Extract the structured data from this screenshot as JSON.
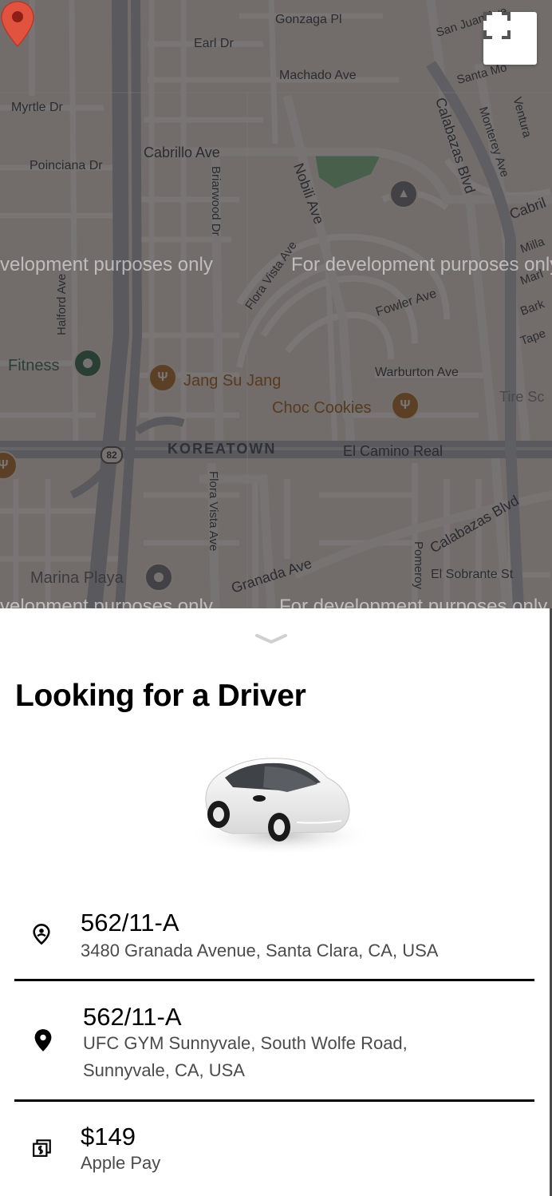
{
  "map": {
    "watermark": "For development purposes only",
    "watermark_fragments": [
      "velopment purposes only",
      "For development purposes only",
      "velopment purposes only",
      "For development purposes only"
    ],
    "labels": {
      "gonzaga": "Gonzaga Pl",
      "san_juan": "San Juan Ave",
      "earl": "Earl Dr",
      "machado": "Machado Ave",
      "santa_monica": "Santa Mo",
      "ventura": "Ventura",
      "myrtle": "Myrtle Dr",
      "cabrillo": "Cabrillo Ave",
      "poinciana": "Poinciana Dr",
      "briarwood": "Briarwood Dr",
      "nobili": "Nobili Ave",
      "calabazas_top": "Calabazas Blvd",
      "monterey": "Monterey Ave",
      "cabrillo_right": "Cabril",
      "milla": "Milla",
      "marl": "Marl",
      "bark": "Bark",
      "tape": "Tape",
      "halford": "Halford Ave",
      "flora_vista_top": "Flora Vista Ave",
      "fowler": "Fowler Ave",
      "fitness": "Fitness",
      "jang_su_jang": "Jang Su Jang",
      "warburton": "Warburton Ave",
      "choc_cookies": "Choc Cookies",
      "tire": "Tire Sc",
      "koreatown": "KOREATOWN",
      "el_camino": "El Camino Real",
      "hwy": "82",
      "flora_vista_bottom": "Flora Vista Ave",
      "calabazas_bottom": "Calabazas Blvd",
      "granada": "Granada Ave",
      "marina_playa": "Marina Playa",
      "pomeroy": "Pomeroy",
      "el_sobrante": "El Sobrante St"
    }
  },
  "controls": {
    "fullscreen_icon": "fullscreen-icon",
    "handle_icon": "chevron-down-icon"
  },
  "sheet": {
    "title": "Looking for a Driver",
    "car_image": "white-car",
    "pickup": {
      "icon": "person-pin-icon",
      "title": "562/11-A",
      "address": "3480 Granada Avenue, Santa Clara, CA, USA"
    },
    "dropoff": {
      "icon": "location-pin-icon",
      "title": "562/11-A",
      "address_line1": "UFC GYM Sunnyvale, South Wolfe Road,",
      "address_line2": "Sunnyvale, CA, USA"
    },
    "payment": {
      "icon": "payments-icon",
      "amount": "$149",
      "method": "Apple Pay"
    }
  },
  "colors": {
    "pin": "#e2533f",
    "title": "#000000",
    "secondary_text": "#4b4b4b"
  }
}
